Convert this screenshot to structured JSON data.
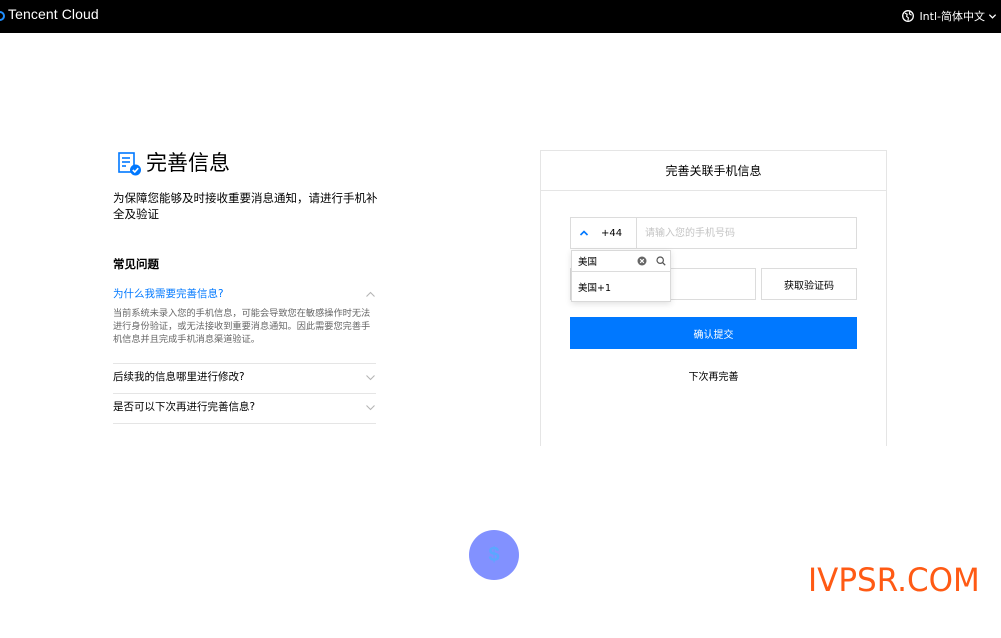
{
  "header": {
    "brand": "Tencent Cloud",
    "language": "Intl-简体中文"
  },
  "intro": {
    "title": "完善信息",
    "description": "为保障您能够及时接收重要消息通知，请进行手机补全及验证"
  },
  "faq": {
    "heading": "常见问题",
    "items": [
      {
        "question": "为什么我需要完善信息?",
        "answer": "当前系统未录入您的手机信息，可能会导致您在敏感操作时无法进行身份验证，或无法接收到重要消息通知。因此需要您完善手机信息并且完成手机消息渠道验证。",
        "expanded": true
      },
      {
        "question": "后续我的信息哪里进行修改?",
        "expanded": false
      },
      {
        "question": "是否可以下次再进行完善信息?",
        "expanded": false
      }
    ]
  },
  "form": {
    "card_title": "完善关联手机信息",
    "country_code": "+44",
    "phone_placeholder": "请输入您的手机号码",
    "get_code_label": "获取验证码",
    "submit_label": "确认提交",
    "later_label": "下次再完善"
  },
  "country_dropdown": {
    "search_value": "美国",
    "options": [
      "美国+1"
    ]
  },
  "float_badge": {
    "symbol": "$"
  },
  "watermark": "IVPSR.COM",
  "colors": {
    "primary": "#0078ff",
    "topbar": "#000000",
    "badge": "#8291ff",
    "watermark": "#ff5a14"
  }
}
